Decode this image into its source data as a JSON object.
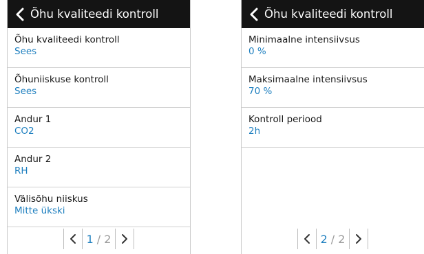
{
  "accent_color": "#1e7fbf",
  "header_color": "#141414",
  "screens": [
    {
      "title": "Õhu kvaliteedi kontroll",
      "items": [
        {
          "label": "Õhu kvaliteedi kontroll",
          "value": "Sees"
        },
        {
          "label": "Õhuniiskuse kontroll",
          "value": "Sees"
        },
        {
          "label": "Andur 1",
          "value": "CO2"
        },
        {
          "label": "Andur 2",
          "value": "RH"
        },
        {
          "label": "Välisõhu niiskus",
          "value": "Mitte ükski"
        }
      ],
      "pager": {
        "current": "1",
        "separator": "/",
        "total": "2"
      }
    },
    {
      "title": "Õhu kvaliteedi kontroll",
      "items": [
        {
          "label": "Minimaalne intensiivsus",
          "value": "0 %"
        },
        {
          "label": "Maksimaalne intensiivsus",
          "value": "70 %"
        },
        {
          "label": "Kontroll periood",
          "value": "2h"
        }
      ],
      "pager": {
        "current": "2",
        "separator": "/",
        "total": "2"
      }
    }
  ],
  "icons": {
    "back": "chevron-left-icon",
    "prev": "chevron-left-icon",
    "next": "chevron-right-icon"
  }
}
